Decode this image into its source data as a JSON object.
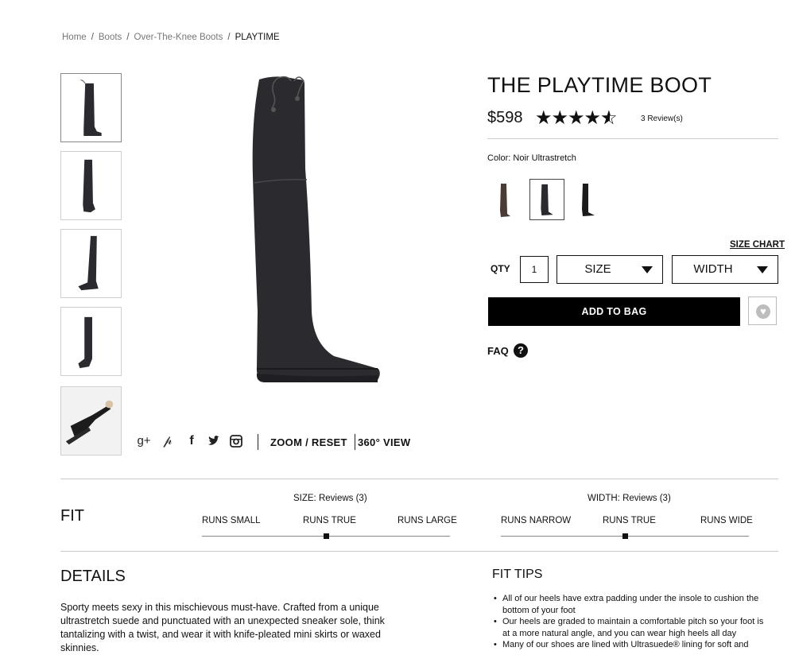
{
  "breadcrumb": {
    "items": [
      "Home",
      "Boots",
      "Over-The-Knee Boots"
    ],
    "current": "PLAYTIME",
    "separator": "/"
  },
  "product": {
    "title": "THE PLAYTIME BOOT",
    "price": "$598",
    "rating": 4.6,
    "rating_max": 5,
    "reviews_label": "3 Review(s)",
    "color_label": "Color: Noir Ultrastretch",
    "swatches": [
      "brown",
      "black",
      "black-alt"
    ],
    "selected_swatch": 1
  },
  "controls": {
    "size_chart": "SIZE CHART",
    "qty_label": "QTY",
    "qty_value": "1",
    "size_label": "SIZE",
    "width_label": "WIDTH",
    "add_to_bag": "ADD TO BAG",
    "faq": "FAQ",
    "faq_icon_glyph": "?"
  },
  "media": {
    "zoom_reset": "ZOOM / RESET",
    "view_360": "360° VIEW",
    "share_icons": [
      "google-plus-icon",
      "pinterest-icon",
      "facebook-icon",
      "twitter-icon",
      "instagram-icon"
    ]
  },
  "fit": {
    "title": "FIT",
    "size_heading": "SIZE: Reviews (3)",
    "size_options": [
      "RUNS SMALL",
      "RUNS TRUE",
      "RUNS LARGE"
    ],
    "size_value": 0.5,
    "width_heading": "WIDTH: Reviews (3)",
    "width_options": [
      "RUNS NARROW",
      "RUNS TRUE",
      "RUNS WIDE"
    ],
    "width_value": 0.5
  },
  "details": {
    "title": "DETAILS",
    "text": "Sporty meets sexy in this mischievous must-have. Crafted from a unique ultrastretch suede and punctuated with an unexpected sneaker sole, think tantalizing with a twist, and wear it with knife-pleated mini skirts or waxed skinnies."
  },
  "fit_tips": {
    "title": "FIT TIPS",
    "items": [
      "All of our heels have extra padding under the insole to cushion the bottom of your foot",
      "Our heels are graded to maintain a comfortable pitch so your foot is at a more natural angle, and you can wear high heels all day",
      "Many of our shoes are lined with Ultrasuede® lining for soft and"
    ]
  },
  "colors": {
    "accent": "#000000",
    "boot": "#2b2a2e",
    "boot_brown": "#4a3c34",
    "border": "#cccccc"
  }
}
